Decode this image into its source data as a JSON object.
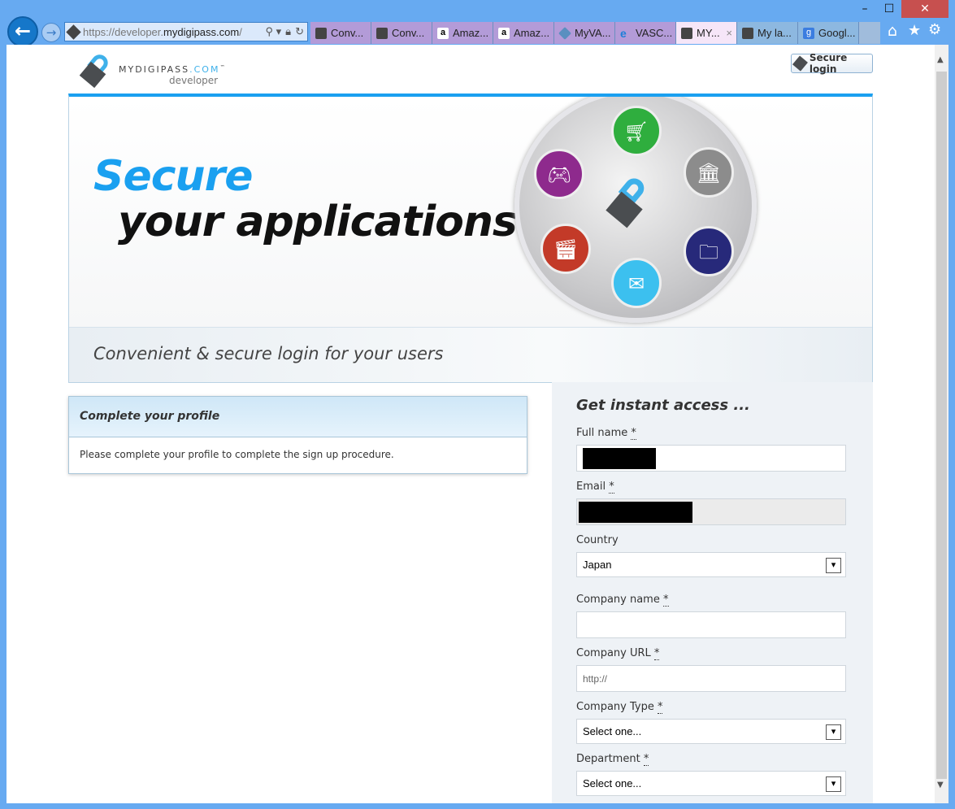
{
  "browser": {
    "url_prefix": "https://developer.",
    "url_domain": "mydigipass.com",
    "url_suffix": "/",
    "tabs": [
      {
        "label": "Conv..."
      },
      {
        "label": "Conv..."
      },
      {
        "label": "Amaz..."
      },
      {
        "label": "Amaz..."
      },
      {
        "label": "MyVA..."
      },
      {
        "label": "VASC..."
      },
      {
        "label": "MY...",
        "active": true
      },
      {
        "label": "My la..."
      },
      {
        "label": "Googl..."
      }
    ],
    "close_tab": "×",
    "minimize": "–",
    "maximize": "☐",
    "close": "✕",
    "home": "⌂",
    "favorites": "★",
    "tools": "⚙",
    "back": "←",
    "forward": "→"
  },
  "header": {
    "logo_name": "MYDIGIPASS",
    "logo_tld": ".COM",
    "logo_tm": "™",
    "logo_sub": "developer",
    "secure_login": "Secure login"
  },
  "banner": {
    "headline1": "Secure",
    "headline2": "your applications",
    "tagline": "Convenient & secure login for your users"
  },
  "profile": {
    "title": "Complete your profile",
    "message": "Please complete your profile to complete the sign up procedure."
  },
  "form": {
    "title": "Get instant access ...",
    "full_name_label": "Full name",
    "email_label": "Email",
    "country_label": "Country",
    "country_value": "Japan",
    "company_name_label": "Company name",
    "company_url_label": "Company URL",
    "company_url_placeholder": "http://",
    "company_type_label": "Company Type",
    "company_type_value": "Select one...",
    "department_label": "Department",
    "department_value": "Select one...",
    "required": "*"
  },
  "colors": {
    "accent": "#1aa0f0",
    "frame": "#67aaf1"
  }
}
